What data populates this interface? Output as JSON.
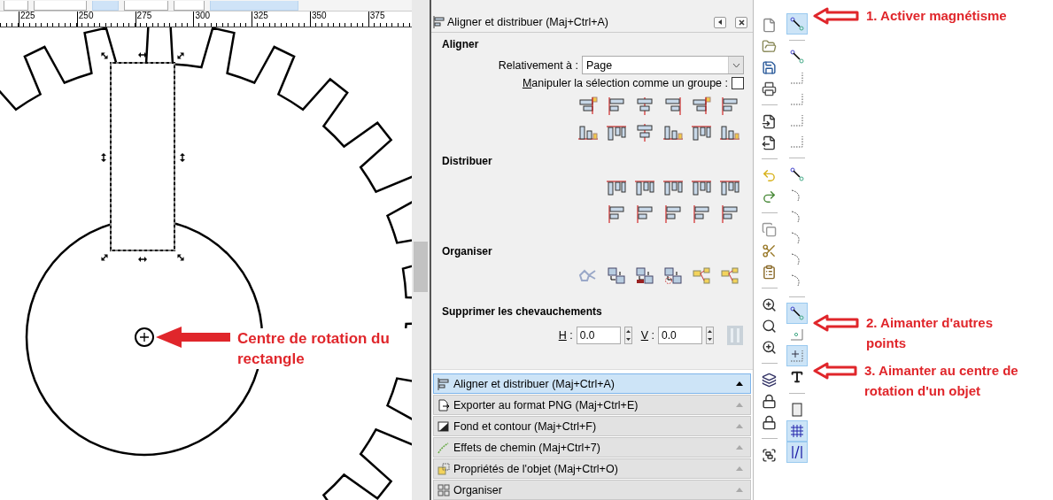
{
  "ruler": {
    "labels": [
      "225",
      "250",
      "275",
      "300",
      "325",
      "350",
      "375"
    ]
  },
  "canvas": {
    "annotation": "Centre de rotation du rectangle"
  },
  "dock": {
    "title": "Aligner et distribuer (Maj+Ctrl+A)",
    "sections": [
      {
        "kind": "align",
        "heading": "Aligner",
        "relative_label": "Relativement à :",
        "relative_value": "Page",
        "group_label": "Manipuler la sélection comme un groupe :",
        "group_checked": false
      },
      {
        "kind": "distribute",
        "heading": "Distribuer"
      },
      {
        "kind": "arrange",
        "heading": "Organiser"
      },
      {
        "kind": "overlap",
        "heading": "Supprimer les chevauchements",
        "fields": [
          {
            "label": "H :",
            "value": "0.0"
          },
          {
            "label": "V :",
            "value": "0.0"
          }
        ]
      }
    ],
    "dialogs": [
      {
        "label": "Aligner et distribuer (Maj+Ctrl+A)",
        "selected": true
      },
      {
        "label": "Exporter au format PNG (Maj+Ctrl+E)",
        "selected": false
      },
      {
        "label": "Fond et contour (Maj+Ctrl+F)",
        "selected": false
      },
      {
        "label": "Effets de chemin (Maj+Ctrl+7)",
        "selected": false
      },
      {
        "label": "Propriétés de l'objet (Maj+Ctrl+O)",
        "selected": false
      },
      {
        "label": "Organiser",
        "selected": false
      }
    ]
  },
  "snap_toolbar": [
    {
      "kind": "button",
      "selected": true
    },
    {
      "kind": "separator"
    },
    {
      "kind": "button",
      "selected": false
    },
    {
      "kind": "button",
      "selected": false
    },
    {
      "kind": "button",
      "selected": false
    },
    {
      "kind": "button",
      "selected": false
    },
    {
      "kind": "button",
      "selected": false
    },
    {
      "kind": "separator"
    },
    {
      "kind": "button",
      "selected": false
    },
    {
      "kind": "button",
      "selected": false
    },
    {
      "kind": "button",
      "selected": false
    },
    {
      "kind": "button",
      "selected": false
    },
    {
      "kind": "button",
      "selected": false
    },
    {
      "kind": "button",
      "selected": false
    },
    {
      "kind": "separator"
    },
    {
      "kind": "button",
      "selected": true
    },
    {
      "kind": "button",
      "selected": false
    },
    {
      "kind": "button",
      "selected": true
    },
    {
      "kind": "button",
      "selected": false
    },
    {
      "kind": "separator"
    },
    {
      "kind": "button",
      "selected": false
    },
    {
      "kind": "button",
      "selected": true
    },
    {
      "kind": "button",
      "selected": true
    }
  ],
  "callouts": [
    {
      "text": "1. Activer magnétisme"
    },
    {
      "text": "2. Aimanter d'autres points"
    },
    {
      "text": "3. Aimanter au centre de rotation d'un objet"
    }
  ]
}
